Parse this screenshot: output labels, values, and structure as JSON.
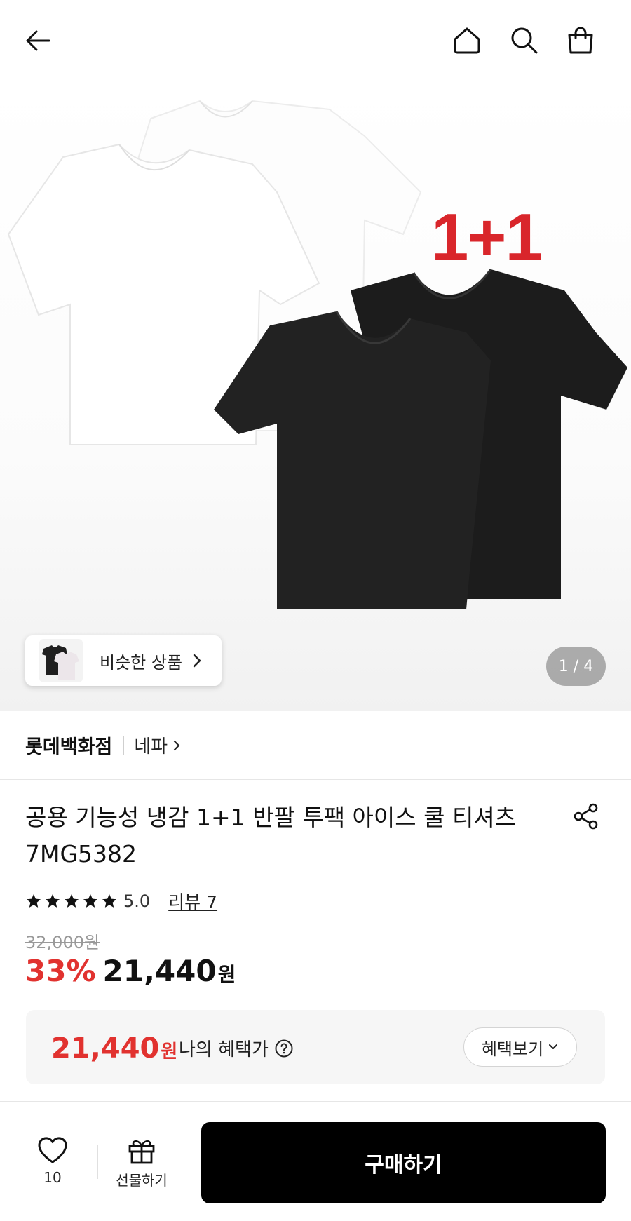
{
  "header": {
    "icons": {
      "back": "arrow-left-icon",
      "home": "home-icon",
      "search": "search-icon",
      "cart": "shopping-bag-icon"
    }
  },
  "gallery": {
    "promo_text": "1+1",
    "similar_label": "비슷한 상품",
    "counter": "1 / 4"
  },
  "product": {
    "brand": "롯데백화점",
    "sub_brand": "네파",
    "title": "공용 기능성 냉감 1+1 반팔 투팩 아이스 쿨 티셔츠 7MG5382",
    "rating": 5,
    "rating_text": "5.0",
    "review_link": "리뷰 7",
    "original_price": "32,000원",
    "discount": "33%",
    "price": "21,440",
    "price_unit": "원"
  },
  "benefit": {
    "amount": "21,440",
    "unit": "원",
    "label": "나의 혜택가",
    "button": "혜택보기"
  },
  "bottom_bar": {
    "wish_count": "10",
    "gift_label": "선물하기",
    "buy_label": "구매하기"
  },
  "colors": {
    "accent_red": "#e1322f",
    "promo_red": "#d9262b",
    "buy_button": "#000000"
  }
}
